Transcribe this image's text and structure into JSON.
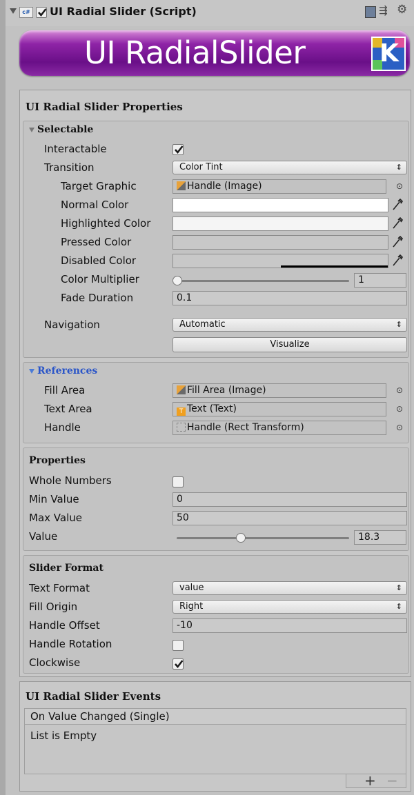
{
  "header": {
    "title": "UI Radial Slider (Script)",
    "icons": [
      "foldout-triangle-icon",
      "csharp-script-icon",
      "enabled-checkbox",
      "help-book-icon",
      "preset-icon",
      "gear-icon"
    ]
  },
  "banner": {
    "text": "UI RadialSlider",
    "logo": "K"
  },
  "properties_section": {
    "title": "UI Radial Slider Properties",
    "selectable": {
      "title": "Selectable",
      "interactable_label": "Interactable",
      "interactable_checked": true,
      "transition_label": "Transition",
      "transition_value": "Color Tint",
      "target_graphic_label": "Target Graphic",
      "target_graphic_value": "Handle (Image)",
      "normal_color_label": "Normal Color",
      "normal_color": "#ffffff",
      "highlighted_color_label": "Highlighted Color",
      "highlighted_color": "#f5f5f5",
      "pressed_color_label": "Pressed Color",
      "pressed_color": "#c8c8c8",
      "disabled_color_label": "Disabled Color",
      "disabled_color": "#c8c8c8",
      "color_multiplier_label": "Color Multiplier",
      "color_multiplier_value": "1",
      "color_multiplier_fraction": 0.0,
      "fade_duration_label": "Fade Duration",
      "fade_duration_value": "0.1",
      "navigation_label": "Navigation",
      "navigation_value": "Automatic",
      "visualize_label": "Visualize"
    },
    "references": {
      "title": "References",
      "fill_area_label": "Fill Area",
      "fill_area_value": "Fill Area (Image)",
      "text_area_label": "Text Area",
      "text_area_value": "Text (Text)",
      "handle_label": "Handle",
      "handle_value": "Handle (Rect Transform)"
    },
    "properties": {
      "title": "Properties",
      "whole_numbers_label": "Whole Numbers",
      "whole_numbers_checked": false,
      "min_value_label": "Min Value",
      "min_value": "0",
      "max_value_label": "Max Value",
      "max_value": "50",
      "value_label": "Value",
      "value": "18.3",
      "value_fraction": 0.366
    },
    "slider_format": {
      "title": "Slider Format",
      "text_format_label": "Text Format",
      "text_format_value": "value",
      "fill_origin_label": "Fill Origin",
      "fill_origin_value": "Right",
      "handle_offset_label": "Handle Offset",
      "handle_offset_value": "-10",
      "handle_rotation_label": "Handle Rotation",
      "handle_rotation_checked": false,
      "clockwise_label": "Clockwise",
      "clockwise_checked": true
    }
  },
  "events_section": {
    "title": "UI Radial Slider Events",
    "list_header": "On Value Changed (Single)",
    "list_body": "List is Empty",
    "add_label": "+",
    "remove_label": "−"
  },
  "dropdown_arrow": "⇕"
}
